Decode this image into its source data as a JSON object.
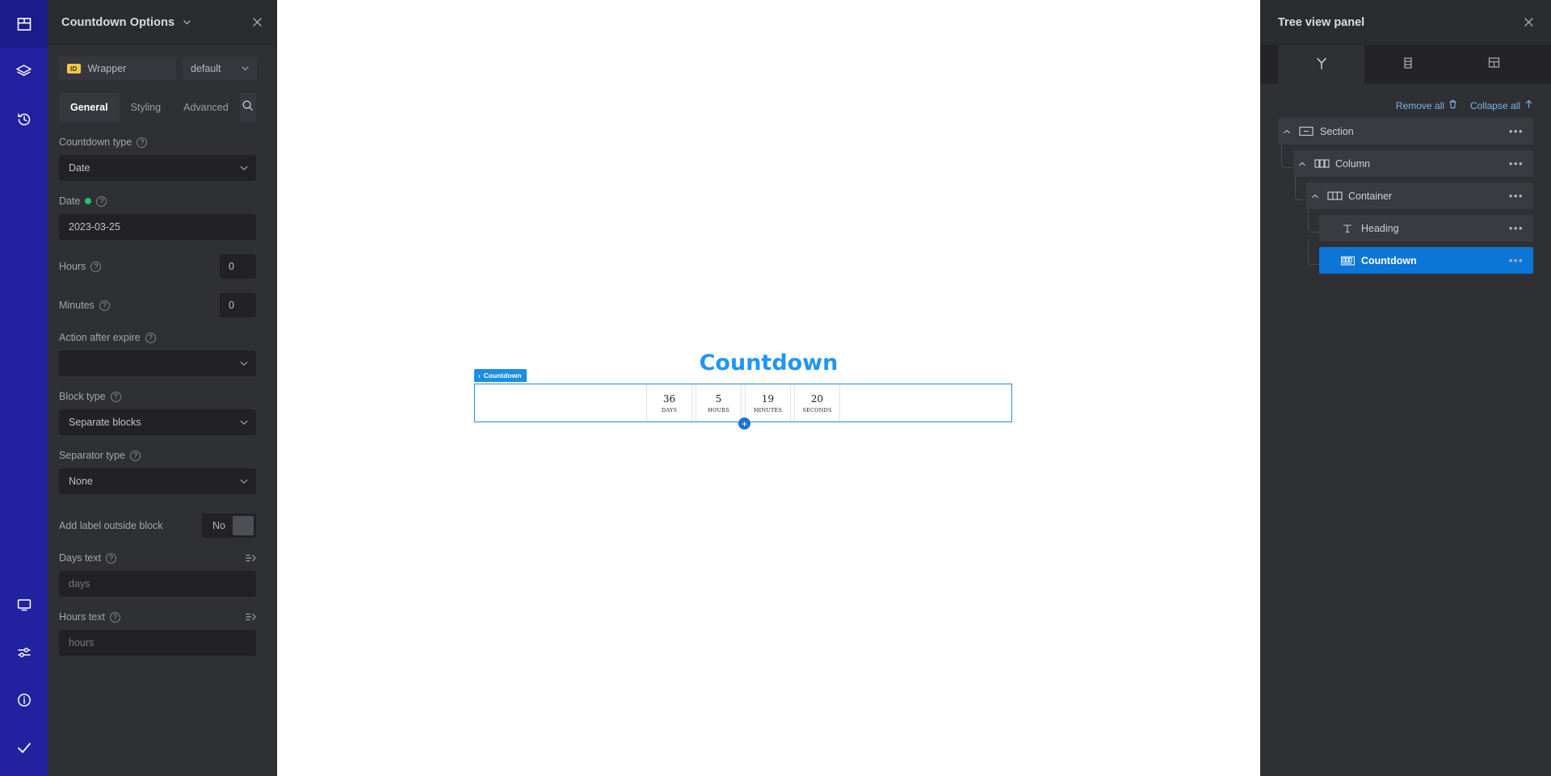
{
  "rail": {
    "top_items": [
      {
        "name": "layout-icon",
        "active": true
      },
      {
        "name": "layers-icon",
        "active": false
      },
      {
        "name": "history-icon",
        "active": false
      }
    ],
    "bottom_items": [
      {
        "name": "monitor-icon"
      },
      {
        "name": "sliders-icon"
      },
      {
        "name": "info-icon"
      },
      {
        "name": "check-icon"
      }
    ]
  },
  "options": {
    "title": "Countdown Options",
    "id_badge": "ID",
    "id_value": "Wrapper",
    "preset_value": "default",
    "tabs": [
      {
        "label": "General",
        "active": true
      },
      {
        "label": "Styling",
        "active": false
      },
      {
        "label": "Advanced",
        "active": false
      }
    ],
    "fields": {
      "countdown_type": {
        "label": "Countdown type",
        "value": "Date"
      },
      "date": {
        "label": "Date",
        "value": "2023-03-25"
      },
      "hours": {
        "label": "Hours",
        "value": "0"
      },
      "minutes": {
        "label": "Minutes",
        "value": "0"
      },
      "action_after_expire": {
        "label": "Action after expire",
        "value": ""
      },
      "block_type": {
        "label": "Block type",
        "value": "Separate blocks"
      },
      "separator_type": {
        "label": "Separator type",
        "value": "None"
      },
      "add_label_outside": {
        "label": "Add label outside block",
        "value": "No"
      },
      "days_text": {
        "label": "Days text",
        "placeholder": "days",
        "value": ""
      },
      "hours_text": {
        "label": "Hours text",
        "placeholder": "hours",
        "value": ""
      }
    }
  },
  "canvas": {
    "heading": "Countdown",
    "widget_tag": "Countdown",
    "add_button": "+",
    "blocks": [
      {
        "value": "36",
        "label": "DAYS"
      },
      {
        "value": "5",
        "label": "HOURS"
      },
      {
        "value": "19",
        "label": "MINUTES"
      },
      {
        "value": "20",
        "label": "SECONDS"
      }
    ]
  },
  "tree": {
    "title": "Tree view panel",
    "tabs": [
      {
        "name": "tree-tab-structure",
        "active": true
      },
      {
        "name": "tree-tab-list",
        "active": false
      },
      {
        "name": "tree-tab-grid",
        "active": false
      }
    ],
    "actions": {
      "remove_all": "Remove all",
      "collapse_all": "Collapse all"
    },
    "nodes": [
      {
        "label": "Section",
        "indent": 0,
        "icon": "section-icon",
        "caret": true,
        "selected": false
      },
      {
        "label": "Column",
        "indent": 1,
        "icon": "column-icon",
        "caret": true,
        "selected": false
      },
      {
        "label": "Container",
        "indent": 2,
        "icon": "container-icon",
        "caret": true,
        "selected": false
      },
      {
        "label": "Heading",
        "indent": 3,
        "icon": "text-icon",
        "caret": false,
        "selected": false
      },
      {
        "label": "Countdown",
        "indent": 3,
        "icon": "countdown-icon",
        "caret": false,
        "selected": true
      }
    ]
  },
  "colors": {
    "rail": "#2222a0",
    "accent_blue": "#0b76d6",
    "canvas_heading": "#2196f3",
    "panel_bg": "#2f3034",
    "field_bg": "#222226"
  }
}
